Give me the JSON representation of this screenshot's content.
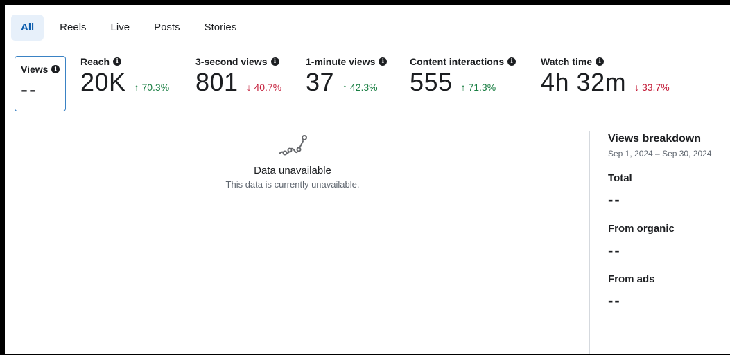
{
  "tabs": [
    {
      "label": "All",
      "active": true
    },
    {
      "label": "Reels",
      "active": false
    },
    {
      "label": "Live",
      "active": false
    },
    {
      "label": "Posts",
      "active": false
    },
    {
      "label": "Stories",
      "active": false
    }
  ],
  "metrics": [
    {
      "label": "Views",
      "value": "--",
      "delta": "",
      "direction": ""
    },
    {
      "label": "Reach",
      "value": "20K",
      "delta": "↑ 70.3%",
      "direction": "up"
    },
    {
      "label": "3-second views",
      "value": "801",
      "delta": "↓ 40.7%",
      "direction": "down"
    },
    {
      "label": "1-minute views",
      "value": "37",
      "delta": "↑ 42.3%",
      "direction": "up"
    },
    {
      "label": "Content interactions",
      "value": "555",
      "delta": "↑ 71.3%",
      "direction": "up"
    },
    {
      "label": "Watch time",
      "value": "4h 32m",
      "delta": "↓ 33.7%",
      "direction": "down"
    }
  ],
  "empty_state": {
    "title": "Data unavailable",
    "subtitle": "This data is currently unavailable."
  },
  "breakdown": {
    "title": "Views breakdown",
    "date_range": "Sep 1, 2024 – Sep 30, 2024",
    "items": [
      {
        "label": "Total",
        "value": "--"
      },
      {
        "label": "From organic",
        "value": "--"
      },
      {
        "label": "From ads",
        "value": "--"
      }
    ]
  },
  "icons": {
    "info": "info-icon",
    "empty_chart": "line-chart-icon"
  },
  "colors": {
    "accent": "#0b5cad",
    "up": "#1a7f43",
    "down": "#c41e3a",
    "selected_border": "#3a82c4"
  }
}
